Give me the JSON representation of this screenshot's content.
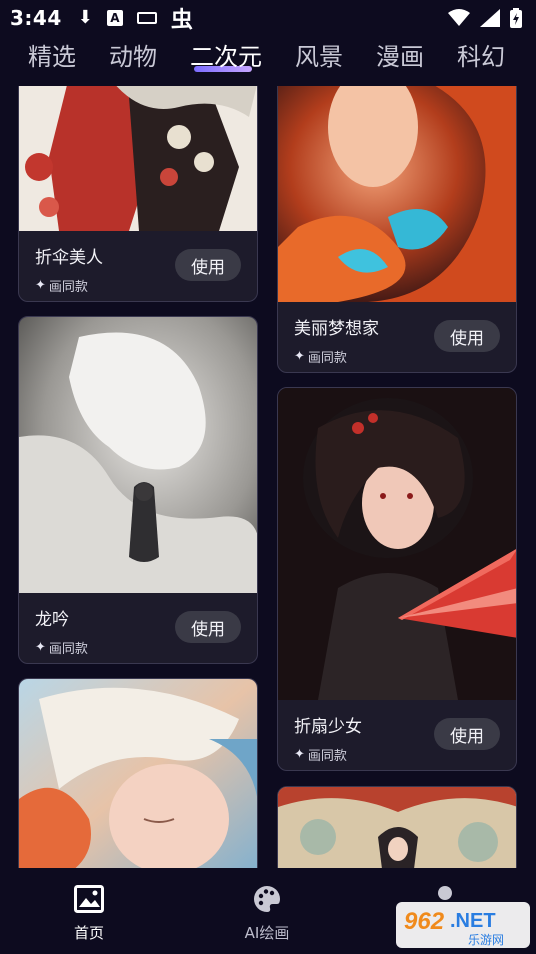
{
  "status_bar": {
    "time": "3:44",
    "icons": [
      "download-icon",
      "a-box-icon",
      "keyboard-icon",
      "bug-icon",
      "wifi-icon",
      "signal-icon",
      "battery-icon"
    ]
  },
  "tabs": [
    {
      "label": "精选"
    },
    {
      "label": "动物"
    },
    {
      "label": "二次元",
      "active": true
    },
    {
      "label": "风景"
    },
    {
      "label": "漫画"
    },
    {
      "label": "科幻"
    }
  ],
  "cards": [
    {
      "title": "折伞美人",
      "sub": "画同款",
      "button": "使用"
    },
    {
      "title": "美丽梦想家",
      "sub": "画同款",
      "button": "使用"
    },
    {
      "title": "龙吟",
      "sub": "画同款",
      "button": "使用"
    },
    {
      "title": "折扇少女",
      "sub": "画同款",
      "button": "使用"
    }
  ],
  "bottom_nav": [
    {
      "label": "首页",
      "icon": "image-icon",
      "active": true
    },
    {
      "label": "AI绘画",
      "icon": "palette-icon"
    },
    {
      "label": "",
      "icon": "profile-icon"
    }
  ],
  "watermark": {
    "number": "962",
    "suffix": ".NET",
    "caption": "乐游网"
  },
  "colors": {
    "background": "#0d0b1f",
    "card": "#1d1b2b",
    "accent": "#7b6cff"
  }
}
